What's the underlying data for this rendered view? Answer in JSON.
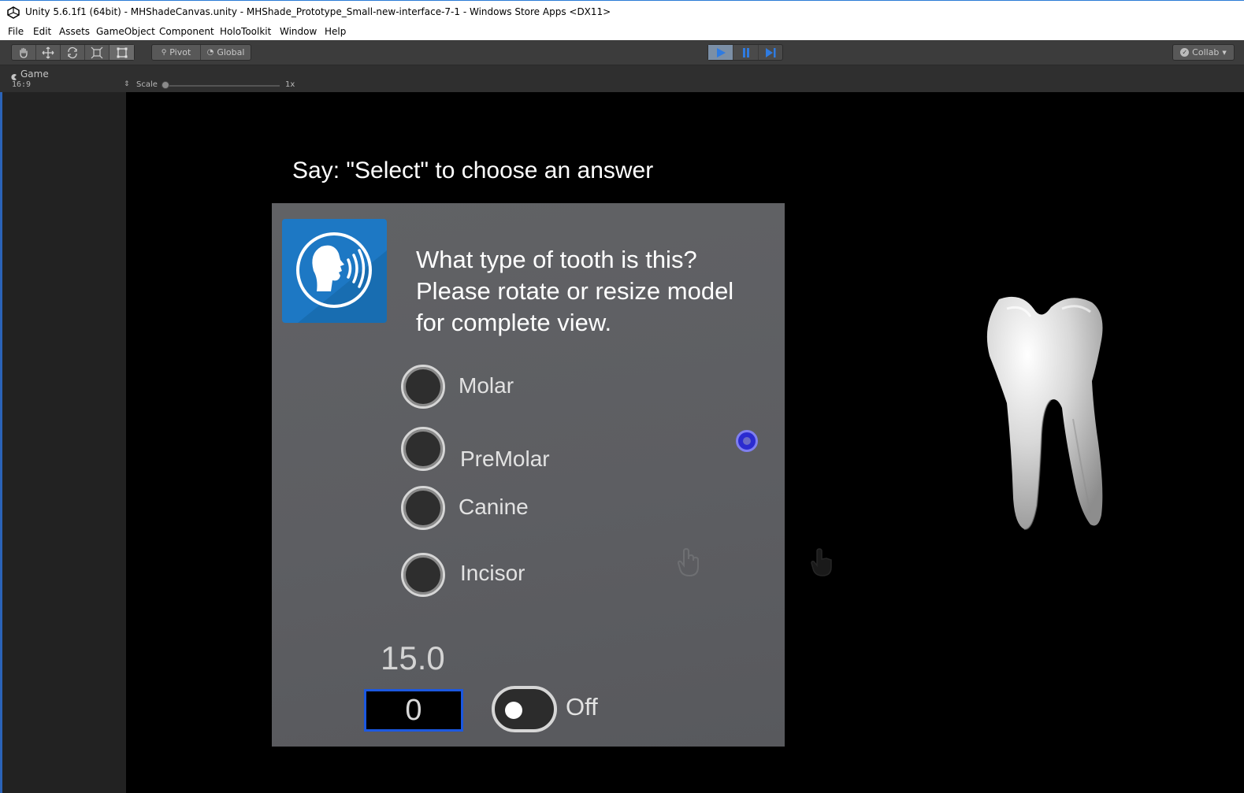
{
  "window": {
    "title": "Unity 5.6.1f1 (64bit) - MHShadeCanvas.unity - MHShade_Prototype_Small-new-interface-7-1 - Windows Store Apps <DX11>"
  },
  "menu": [
    "File",
    "Edit",
    "Assets",
    "GameObject",
    "Component",
    "HoloToolkit",
    "Window",
    "Help"
  ],
  "toolbar": {
    "pivot_label": "Pivot",
    "global_label": "Global",
    "collab_label": "Collab",
    "tools": [
      "hand-tool-icon",
      "move-tool-icon",
      "rotate-tool-icon",
      "scale-tool-icon",
      "rect-tool-icon"
    ]
  },
  "game_view": {
    "tab_label": "Game",
    "aspect": "16:9",
    "scale_label": "Scale",
    "scale_value": "1x"
  },
  "scene": {
    "instruction": "Say: \"Select\" to choose an answer",
    "question_lines": [
      "What type of tooth is this?",
      "Please rotate or resize model",
      "for complete view."
    ],
    "options": [
      "Molar",
      "PreMolar",
      "Canine",
      "Incisor"
    ],
    "value_display": "15.0",
    "input_value": "0",
    "toggle_label": "Off",
    "toggle_on": false
  },
  "colors": {
    "accent_blue": "#1d78c4",
    "panel_gray": "#5e5f63",
    "input_border": "#1c58e0",
    "gaze_cursor": "#2b2bd0"
  }
}
